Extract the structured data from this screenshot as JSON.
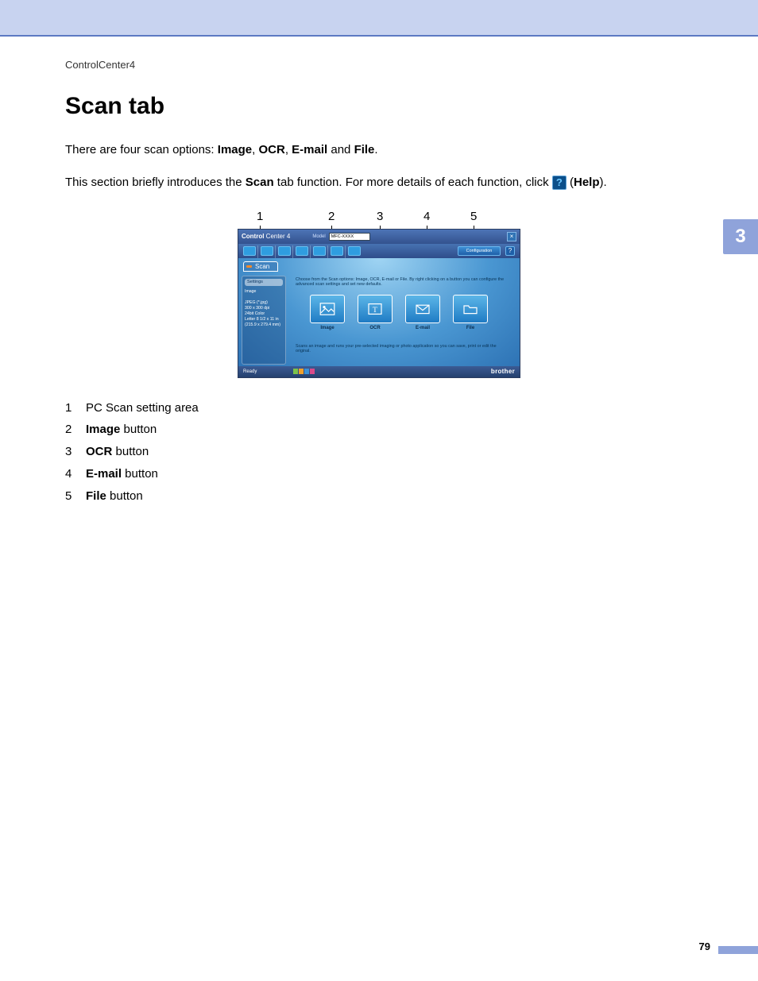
{
  "header": {
    "breadcrumb": "ControlCenter4"
  },
  "chapter_tab": "3",
  "title": "Scan tab",
  "intro": {
    "prefix": "There are four scan options: ",
    "opt1": "Image",
    "sep1": ", ",
    "opt2": "OCR",
    "sep2": ", ",
    "opt3": "E-mail",
    "sep3": " and ",
    "opt4": "File",
    "suffix": "."
  },
  "intro2": {
    "part1": "This section briefly introduces the ",
    "bold1": "Scan",
    "part2": " tab function. For more details of each function, click ",
    "help_glyph": "?",
    "part3": " (",
    "bold2": "Help",
    "part4": ")."
  },
  "callouts": {
    "1": "1",
    "2": "2",
    "3": "3",
    "4": "4",
    "5": "5"
  },
  "screenshot": {
    "logo_bold": "Control",
    "logo_rest": " Center 4",
    "model_label": "Model",
    "model_value": "MFC-XXXX",
    "close": "×",
    "config_label": "Configuration",
    "help": "?",
    "scan_label": "Scan",
    "settings_header": "Settings",
    "settings_lines": "Image\n\nJPEG (*.jpg)\n300 x 300 dpi\n24bit Color\nLetter 8 1/2 x 11 in\n(215.9 x 279.4 mm)",
    "instruction": "Choose from the Scan options: Image, OCR, E-mail or File. By right clicking on a button you can configure the advanced scan settings and set new defaults.",
    "buttons": {
      "image": "Image",
      "ocr": "OCR",
      "email": "E-mail",
      "file": "File"
    },
    "description": "Scans an image and runs your pre-selected imaging or photo application so you can save, print or edit the original.",
    "status": "Ready",
    "brand": "brother"
  },
  "legend": {
    "1": {
      "num": "1",
      "text": "PC Scan setting area"
    },
    "2": {
      "num": "2",
      "bold": "Image",
      "rest": " button"
    },
    "3": {
      "num": "3",
      "bold": "OCR",
      "rest": " button"
    },
    "4": {
      "num": "4",
      "bold": "E-mail",
      "rest": " button"
    },
    "5": {
      "num": "5",
      "bold": "File",
      "rest": " button"
    }
  },
  "page_number": "79"
}
